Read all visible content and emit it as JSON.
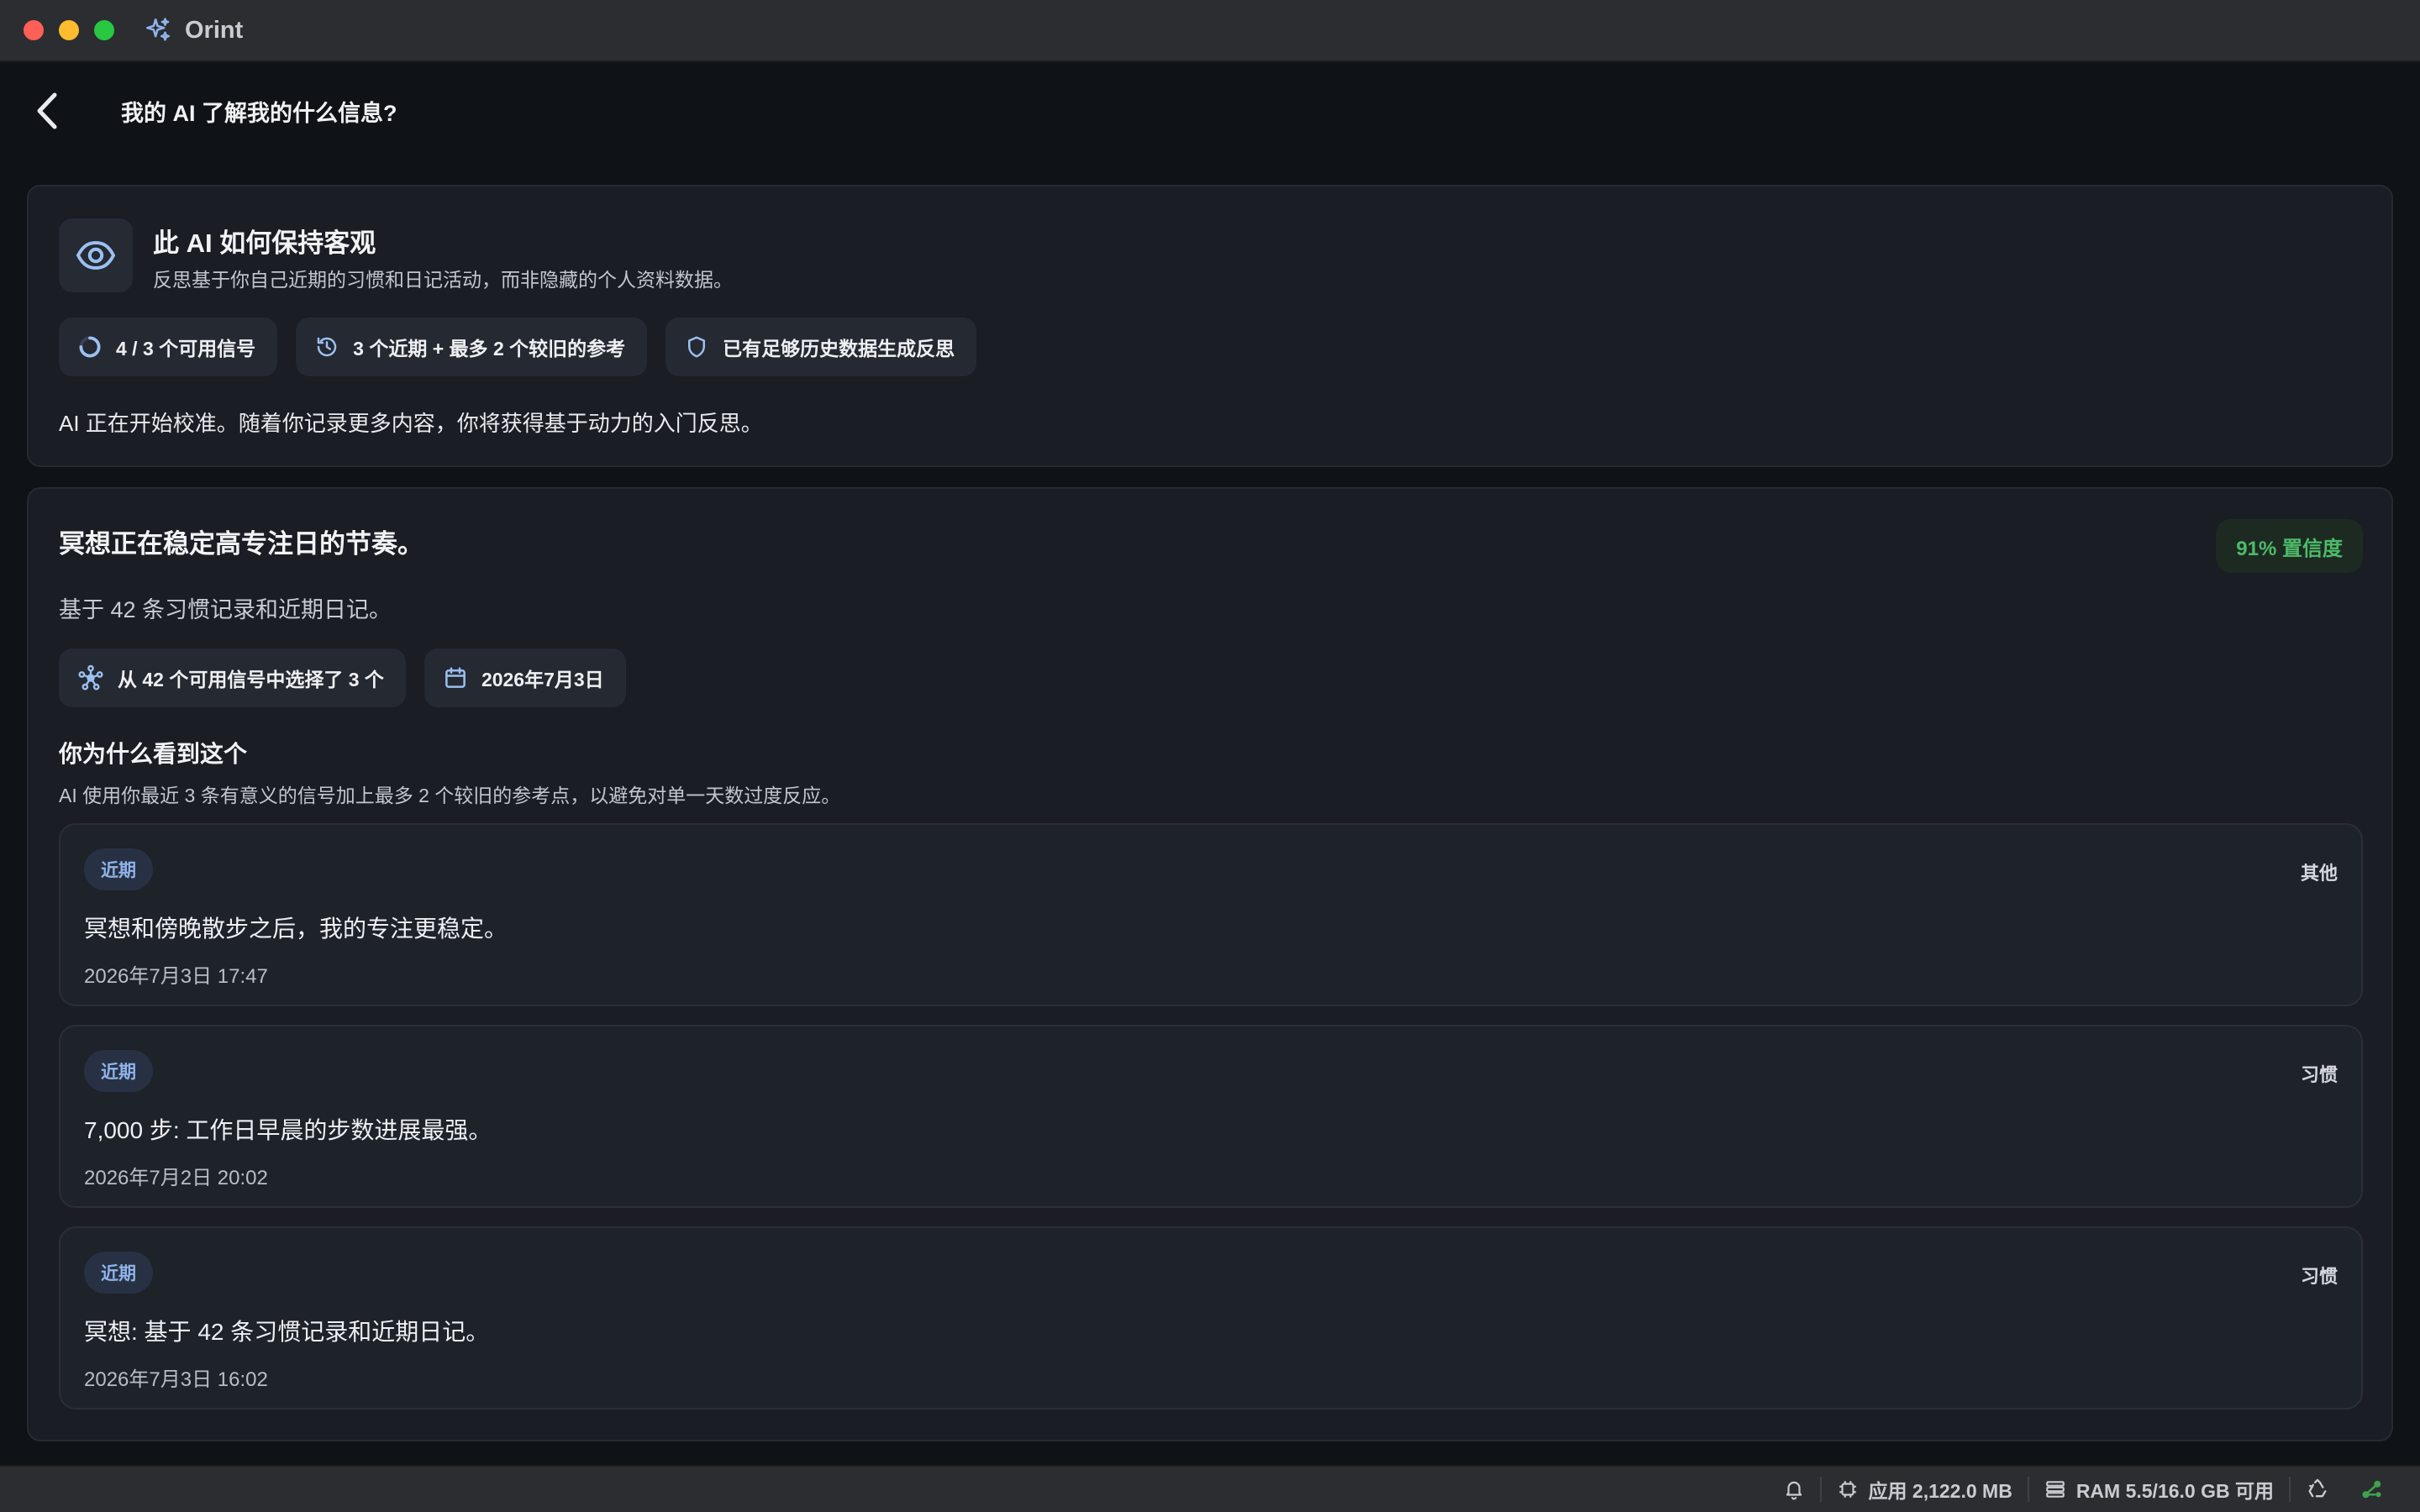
{
  "window": {
    "app_name": "Orint"
  },
  "header": {
    "title": "我的 AI 了解我的什么信息?"
  },
  "objectivity": {
    "title": "此 AI 如何保持客观",
    "subtitle": "反思基于你自己近期的习惯和日记活动，而非隐藏的个人资料数据。",
    "chips": [
      {
        "icon": "progress-ring-icon",
        "label": "4 / 3 个可用信号"
      },
      {
        "icon": "history-clock-icon",
        "label": "3 个近期 + 最多 2 个较旧的参考"
      },
      {
        "icon": "shield-icon",
        "label": "已有足够历史数据生成反思"
      }
    ],
    "description": "AI 正在开始校准。随着你记录更多内容，你将获得基于动力的入门反思。"
  },
  "insight": {
    "title": "冥想正在稳定高专注日的节奏。",
    "confidence": "91% 置信度",
    "subtitle": "基于 42 条习惯记录和近期日记。",
    "chips": [
      {
        "icon": "network-icon",
        "label": "从 42 个可用信号中选择了 3 个"
      },
      {
        "icon": "calendar-icon",
        "label": "2026年7月3日"
      }
    ],
    "why_title": "你为什么看到这个",
    "why_description": "AI 使用你最近 3 条有意义的信号加上最多 2 个较旧的参考点，以避免对单一天数过度反应。",
    "entries": [
      {
        "tag": "近期",
        "category": "其他",
        "text": "冥想和傍晚散步之后，我的专注更稳定。",
        "time": "2026年7月3日 17:47"
      },
      {
        "tag": "近期",
        "category": "习惯",
        "text": "7,000 步: 工作日早晨的步数进展最强。",
        "time": "2026年7月2日 20:02"
      },
      {
        "tag": "近期",
        "category": "习惯",
        "text": "冥想: 基于 42 条习惯记录和近期日记。",
        "time": "2026年7月3日 16:02"
      }
    ]
  },
  "statusbar": {
    "app_memory": "应用 2,122.0 MB",
    "ram": "RAM 5.5/16.0 GB 可用"
  },
  "colors": {
    "background": "#0f1217",
    "card": "#1a1d23",
    "accent_blue": "#8fb4ea",
    "confidence_green": "#4dbb6a"
  }
}
